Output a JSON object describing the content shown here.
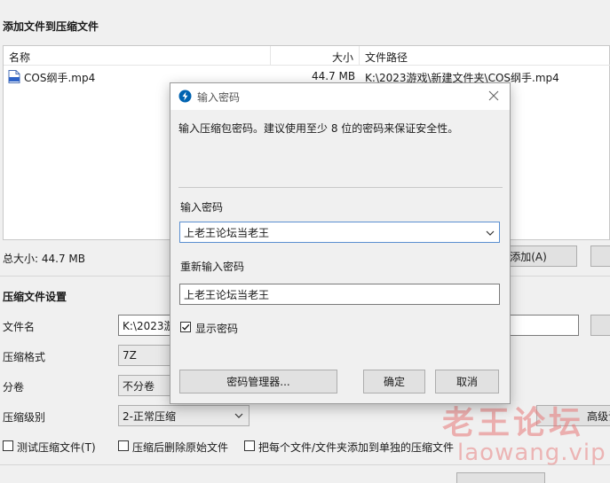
{
  "add_files": {
    "title": "添加文件到压缩文件",
    "columns": {
      "name": "名称",
      "size": "大小",
      "path": "文件路径"
    },
    "files": [
      {
        "name": "COS纲手.mp4",
        "size": "44.7 MB",
        "path": "K:\\2023游戏\\新建文件夹\\COS纲手.mp4",
        "icon": "mp4-file-icon"
      }
    ],
    "total_size": "总大小: 44.7 MB",
    "add_button": "添加(A)"
  },
  "settings": {
    "title": "压缩文件设置",
    "filename_label": "文件名",
    "filename_value": "K:\\2023游",
    "format_label": "压缩格式",
    "format_value": "7Z",
    "split_label": "分卷",
    "split_value": "不分卷",
    "level_label": "压缩级别",
    "level_value": "2-正常压缩",
    "advanced_button": "高级设",
    "options": [
      {
        "label": "测试压缩文件(T)",
        "checked": false
      },
      {
        "label": "压缩后删除原始文件",
        "checked": false
      },
      {
        "label": "把每个文件/文件夹添加到单独的压缩文件",
        "checked": false
      }
    ]
  },
  "dialog": {
    "title": "输入密码",
    "description": "输入压缩包密码。建议使用至少 8 位的密码来保证安全性。",
    "password_label": "输入密码",
    "password_value": "上老王论坛当老王",
    "confirm_label": "重新输入密码",
    "confirm_value": "上老王论坛当老王",
    "show_password_label": "显示密码",
    "show_password_checked": true,
    "manager_button": "密码管理器...",
    "ok_button": "确定",
    "cancel_button": "取消",
    "accent_color": "#0063b1"
  },
  "watermark": {
    "cn": "老王论坛",
    "en": "laowang.vip"
  }
}
